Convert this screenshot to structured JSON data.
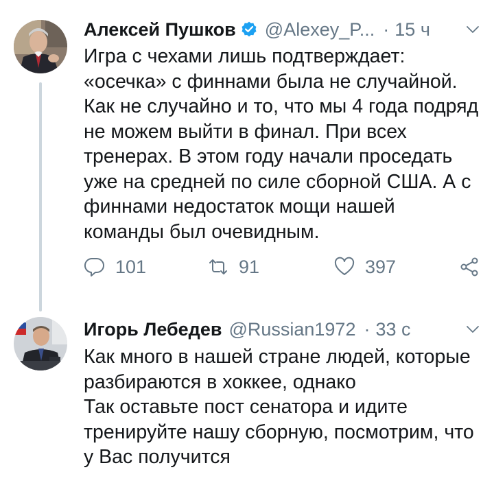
{
  "tweets": [
    {
      "author": "Алексей Пушков",
      "handle": "@Alexey_P...",
      "separator": "·",
      "time": "15 ч",
      "verified": true,
      "lines": [
        "Игра с чехами лишь подтверждает:",
        "«осечка» с финнами была не случайной.",
        "Как не случайно и то, что мы 4 года подряд",
        "не можем выйти в финал. При всех",
        "тренерах. В этом году начали проседать",
        "уже на средней по силе сборной США. А с",
        "финнами недостаток мощи нашей",
        "команды был очевидным."
      ],
      "replies": "101",
      "retweets": "91",
      "likes": "397"
    },
    {
      "author": "Игорь Лебедев",
      "handle": "@Russian1972",
      "separator": "·",
      "time": "33 с",
      "verified": false,
      "lines": [
        "Как много в нашей стране людей, которые",
        "разбираются в хоккее, однако",
        "Так оставьте пост сенатора и идите",
        "тренируйте нашу сборную, посмотрим, что",
        "у Вас получится"
      ]
    }
  ],
  "colors": {
    "text": "#14171a",
    "secondary": "#657786",
    "verified": "#1da1f2",
    "thread_line": "#ccd6dd"
  },
  "icons": [
    "reply-icon",
    "retweet-icon",
    "like-icon",
    "share-icon",
    "verified-badge-icon",
    "chevron-down-icon"
  ]
}
